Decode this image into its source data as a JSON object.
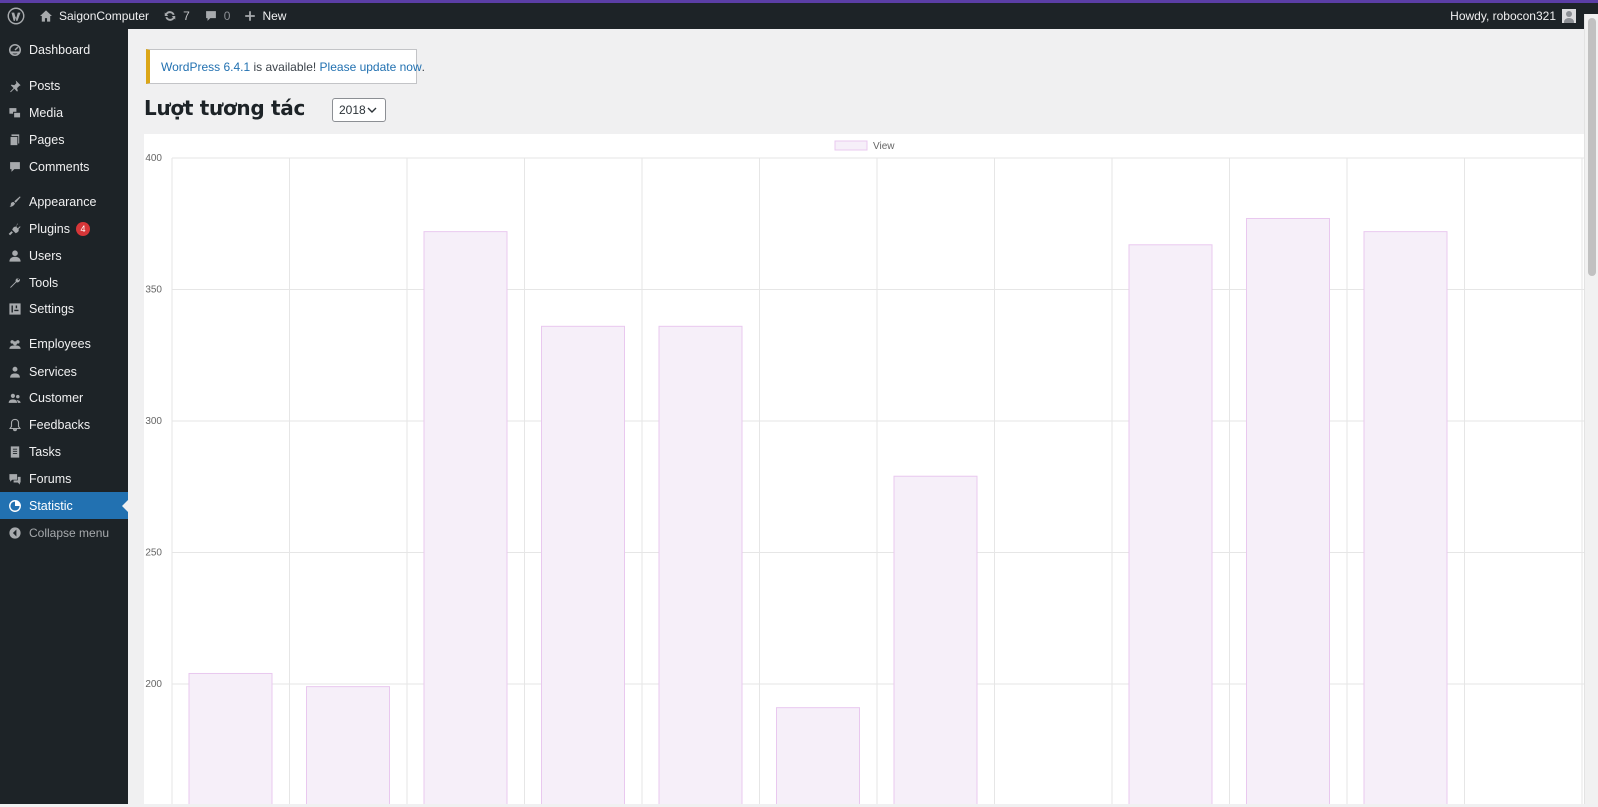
{
  "admin_bar": {
    "site_name": "SaigonComputer",
    "updates_count": "7",
    "comments_count": "0",
    "new_label": "New",
    "greeting": "Howdy, robocon321"
  },
  "sidebar": {
    "items": [
      {
        "label": "Dashboard",
        "icon": "dashboard-icon"
      },
      {
        "label": "Posts",
        "icon": "pin-icon"
      },
      {
        "label": "Media",
        "icon": "media-icon"
      },
      {
        "label": "Pages",
        "icon": "pages-icon"
      },
      {
        "label": "Comments",
        "icon": "comment-icon"
      },
      {
        "label": "Appearance",
        "icon": "brush-icon"
      },
      {
        "label": "Plugins",
        "icon": "plugin-icon",
        "badge": "4"
      },
      {
        "label": "Users",
        "icon": "user-icon"
      },
      {
        "label": "Tools",
        "icon": "wrench-icon"
      },
      {
        "label": "Settings",
        "icon": "settings-icon"
      },
      {
        "label": "Employees",
        "icon": "groups-icon"
      },
      {
        "label": "Services",
        "icon": "services-icon"
      },
      {
        "label": "Customer",
        "icon": "customer-icon"
      },
      {
        "label": "Feedbacks",
        "icon": "bell-icon"
      },
      {
        "label": "Tasks",
        "icon": "tasks-icon"
      },
      {
        "label": "Forums",
        "icon": "forum-icon"
      },
      {
        "label": "Statistic",
        "icon": "chart-icon",
        "current": true
      }
    ],
    "collapse_label": "Collapse menu"
  },
  "notice": {
    "version_link": "WordPress 6.4.1",
    "middle_text": "is available!",
    "update_link": "Please update now",
    "period": "."
  },
  "page": {
    "title": "Lượt tương tác",
    "year_selected": "2018"
  },
  "chart_data": {
    "type": "bar",
    "series": [
      {
        "name": "View",
        "values": [
          204,
          199,
          372,
          336,
          336,
          191,
          279,
          null,
          367,
          377,
          372,
          null
        ]
      }
    ],
    "y_ticks": [
      200,
      250,
      300,
      350,
      400
    ],
    "ylim_visible": [
      160,
      400
    ],
    "grid": true,
    "legend_position": "top-center",
    "colors": {
      "bar_fill": "#f6eff9",
      "bar_stroke": "#e9c8ef",
      "grid": "#e6e6e6",
      "tick_text": "#666666"
    }
  },
  "colors": {
    "admin_bar": "#1d2327",
    "current_menu": "#2271b1",
    "link": "#2271b1",
    "notice_border": "#dba617",
    "badge": "#d63638"
  }
}
